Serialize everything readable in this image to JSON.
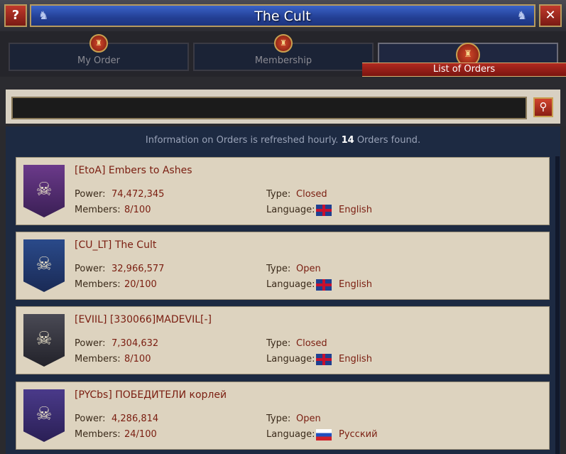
{
  "window": {
    "title": "The Cult",
    "help_label": "?",
    "close_label": "✕"
  },
  "tabs": [
    {
      "label": "My Order",
      "medal": "♜"
    },
    {
      "label": "Membership",
      "medal": "♜"
    },
    {
      "label": "List of Orders",
      "medal": "♜"
    }
  ],
  "search": {
    "value": "",
    "placeholder": ""
  },
  "info": {
    "prefix": "Information on Orders is refreshed hourly.",
    "count": "14",
    "suffix": "Orders found."
  },
  "labels": {
    "power": "Power:",
    "members": "Members:",
    "type": "Type:",
    "language": "Language:"
  },
  "orders": [
    {
      "name": "[EtoA] Embers to Ashes",
      "power": "74,472,345",
      "members": "8/100",
      "type": "Closed",
      "language": "English",
      "flag": "uk",
      "emblem": "☠",
      "emblem_color": "#6b3a8a"
    },
    {
      "name": "[CU_LT] The Cult",
      "power": "32,966,577",
      "members": "20/100",
      "type": "Open",
      "language": "English",
      "flag": "uk",
      "emblem": "☠",
      "emblem_color": "#2a4a8a"
    },
    {
      "name": "[EVIIL] [330066]MADEVIL[-]",
      "power": "7,304,632",
      "members": "8/100",
      "type": "Closed",
      "language": "English",
      "flag": "uk",
      "emblem": "☠",
      "emblem_color": "#3a3a44"
    },
    {
      "name": "[PYCbs] ПОБЕДИТЕЛИ корлей",
      "power": "4,286,814",
      "members": "24/100",
      "type": "Open",
      "language": "Русский",
      "flag": "ru",
      "emblem": "☠",
      "emblem_color": "#4a3a8a"
    }
  ]
}
